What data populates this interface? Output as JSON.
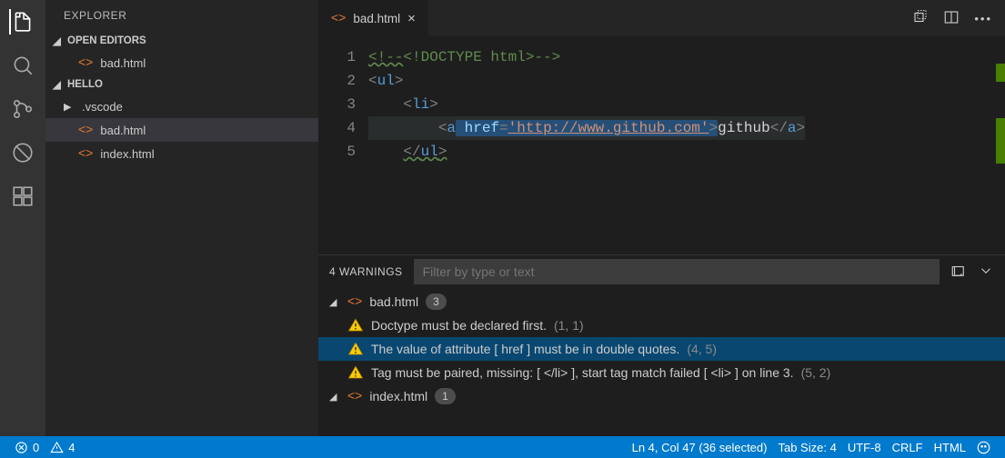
{
  "sidebar": {
    "title": "EXPLORER",
    "sections": {
      "openEditors": {
        "label": "OPEN EDITORS",
        "items": [
          {
            "name": "bad.html"
          }
        ]
      },
      "workspace": {
        "label": "HELLO",
        "items": [
          {
            "name": ".vscode",
            "type": "folder"
          },
          {
            "name": "bad.html",
            "type": "file",
            "selected": true
          },
          {
            "name": "index.html",
            "type": "file"
          }
        ]
      }
    }
  },
  "tabs": {
    "active": "bad.html"
  },
  "code": {
    "lines": [
      {
        "num": "1",
        "text": "<!--<!DOCTYPE html>-->"
      },
      {
        "num": "2",
        "text": "<ul>"
      },
      {
        "num": "3",
        "text": "    <li>"
      },
      {
        "num": "4",
        "text": "        <a href='http://www.github.com'>github</a>"
      },
      {
        "num": "5",
        "text": "    </ul>"
      }
    ]
  },
  "problems": {
    "headerCount": "4 WARNINGS",
    "filterPlaceholder": "Filter by type or text",
    "files": [
      {
        "name": "bad.html",
        "count": "3",
        "items": [
          {
            "msg": "Doctype must be declared first.",
            "loc": "(1, 1)"
          },
          {
            "msg": "The value of attribute [ href ] must be in double quotes.",
            "loc": "(4, 5)",
            "selected": true
          },
          {
            "msg": "Tag must be paired, missing: [ </li> ], start tag match failed [ <li> ] on line 3.",
            "loc": "(5, 2)"
          }
        ]
      },
      {
        "name": "index.html",
        "count": "1",
        "items": []
      }
    ]
  },
  "status": {
    "errors": "0",
    "warnings": "4",
    "lncol": "Ln 4, Col 47 (36 selected)",
    "tabsize": "Tab Size: 4",
    "encoding": "UTF-8",
    "eol": "CRLF",
    "lang": "HTML"
  }
}
